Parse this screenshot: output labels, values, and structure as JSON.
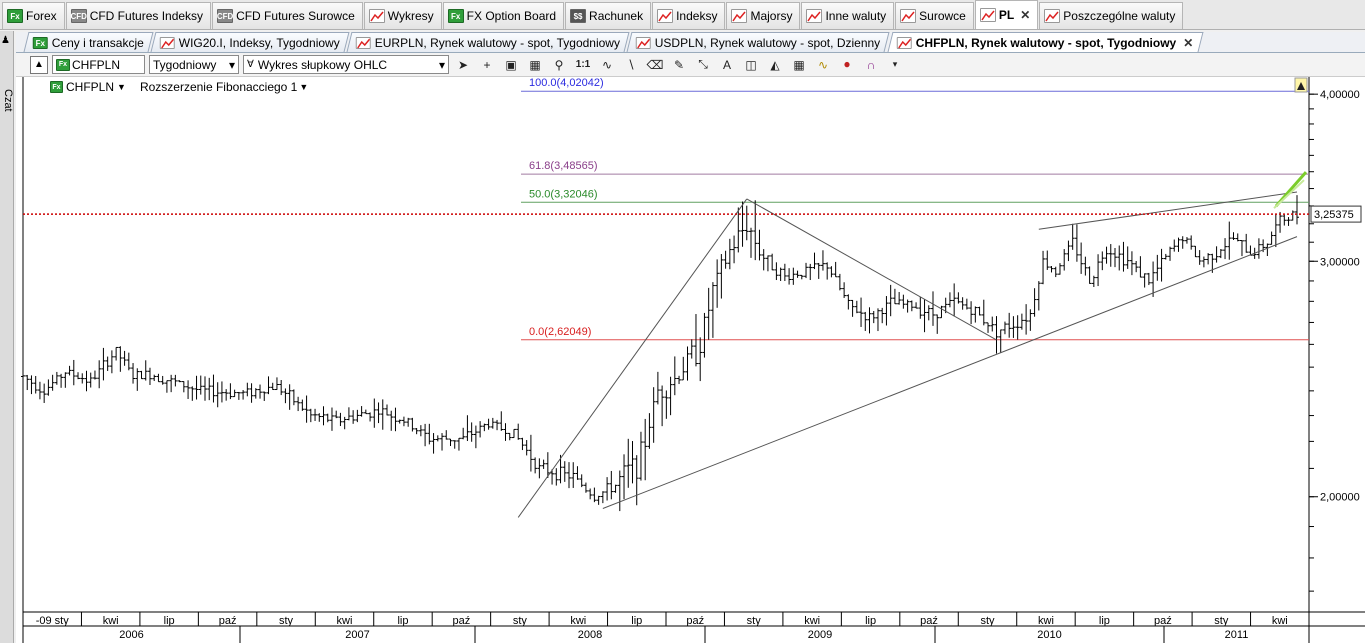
{
  "top_tabs": [
    {
      "label": "Forex",
      "icon": "fx-icon"
    },
    {
      "label": "CFD Futures Indeksy",
      "icon": "cfd-icon"
    },
    {
      "label": "CFD Futures Surowce",
      "icon": "cfd-icon"
    },
    {
      "label": "Wykresy",
      "icon": "chart-icon"
    },
    {
      "label": "FX Option Board",
      "icon": "fx-icon"
    },
    {
      "label": "Rachunek",
      "icon": "bank-icon"
    },
    {
      "label": "Indeksy",
      "icon": "chart-icon"
    },
    {
      "label": "Majorsy",
      "icon": "chart-icon"
    },
    {
      "label": "Inne waluty",
      "icon": "chart-icon"
    },
    {
      "label": "Surowce",
      "icon": "chart-icon"
    },
    {
      "label": "PL",
      "icon": "chart-icon",
      "active": true,
      "closable": true
    },
    {
      "label": "Poszczególne waluty",
      "icon": "chart-icon"
    }
  ],
  "left_strip": {
    "label": "Czat"
  },
  "sub_tabs": [
    {
      "label": "Ceny i transakcje",
      "icon": "fx-icon"
    },
    {
      "label": "WIG20.I, Indeksy, Tygodniowy",
      "icon": "chart-icon"
    },
    {
      "label": "EURPLN, Rynek walutowy - spot, Tygodniowy",
      "icon": "chart-icon"
    },
    {
      "label": "USDPLN, Rynek walutowy - spot, Dzienny",
      "icon": "chart-icon"
    },
    {
      "label": "CHFPLN, Rynek walutowy - spot, Tygodniowy",
      "icon": "chart-icon",
      "active": true,
      "closable": true
    }
  ],
  "toolbar": {
    "symbol": "CHFPLN",
    "period": "Tygodniowy",
    "chart_type": "Wykres słupkowy OHLC",
    "one_to_one": "1:1"
  },
  "chart_header": {
    "instrument": "CHFPLN",
    "study": "Rozszerzenie Fibonacciego 1"
  },
  "colors": {
    "fib100": "#2b2be0",
    "fib618": "#8a3f8a",
    "fib50": "#2a8a2a",
    "fib0": "#d81e1e",
    "price": "#cc0000",
    "arrow": "#7ccd2b"
  },
  "chart_data": {
    "type": "ohlc",
    "instrument": "CHFPLN",
    "timeframe": "Tygodniowy",
    "y_axis": {
      "scale": "log",
      "ylim": [
        1.64,
        4.12
      ],
      "ticks": [
        "4,00000",
        "3,00000",
        "2,00000"
      ],
      "tick_values": [
        4.0,
        3.0,
        2.0
      ]
    },
    "current_price": {
      "label": "3,25375",
      "value": 3.25375
    },
    "fib_levels": [
      {
        "label": "100.0(4,02042)",
        "value": 4.02042
      },
      {
        "label": "61.8(3,48565)",
        "value": 3.48565
      },
      {
        "label": "50.0(3,32046)",
        "value": 3.32046
      },
      {
        "label": "0.0(2,62049)",
        "value": 2.62049
      }
    ],
    "x_months": [
      "-09 sty",
      "kwi",
      "lip",
      "paź",
      "sty",
      "kwi",
      "lip",
      "paź",
      "sty",
      "kwi",
      "lip",
      "paź",
      "sty",
      "kwi",
      "lip",
      "paź",
      "sty",
      "kwi",
      "lip",
      "paź",
      "sty",
      "kwi"
    ],
    "x_years": [
      "2006",
      "2007",
      "2008",
      "2009",
      "2010",
      "2011"
    ],
    "x_range_weeks": [
      0,
      301
    ],
    "trend_lines": [
      {
        "name": "impulse",
        "from": [
          117,
          1.93
        ],
        "to": [
          171,
          3.34
        ]
      },
      {
        "name": "retrace",
        "from": [
          171,
          3.34
        ],
        "to": [
          230,
          2.62
        ]
      },
      {
        "name": "support",
        "from": [
          137,
          1.96
        ],
        "to": [
          301,
          3.13
        ]
      },
      {
        "name": "resistance",
        "from": [
          240,
          3.17
        ],
        "to": [
          301,
          3.38
        ]
      }
    ],
    "anchors": [
      {
        "t": 0,
        "p": 2.46
      },
      {
        "t": 5,
        "p": 2.4
      },
      {
        "t": 10,
        "p": 2.48
      },
      {
        "t": 16,
        "p": 2.44
      },
      {
        "t": 22,
        "p": 2.57
      },
      {
        "t": 26,
        "p": 2.46
      },
      {
        "t": 30,
        "p": 2.47
      },
      {
        "t": 35,
        "p": 2.44
      },
      {
        "t": 42,
        "p": 2.4
      },
      {
        "t": 52,
        "p": 2.39
      },
      {
        "t": 60,
        "p": 2.42
      },
      {
        "t": 68,
        "p": 2.3
      },
      {
        "t": 74,
        "p": 2.28
      },
      {
        "t": 84,
        "p": 2.32
      },
      {
        "t": 90,
        "p": 2.28
      },
      {
        "t": 96,
        "p": 2.21
      },
      {
        "t": 104,
        "p": 2.21
      },
      {
        "t": 110,
        "p": 2.27
      },
      {
        "t": 116,
        "p": 2.23
      },
      {
        "t": 122,
        "p": 2.1
      },
      {
        "t": 130,
        "p": 2.07
      },
      {
        "t": 135,
        "p": 2.0
      },
      {
        "t": 140,
        "p": 2.04
      },
      {
        "t": 146,
        "p": 2.14
      },
      {
        "t": 150,
        "p": 2.4
      },
      {
        "t": 154,
        "p": 2.45
      },
      {
        "t": 160,
        "p": 2.6
      },
      {
        "t": 163,
        "p": 2.85
      },
      {
        "t": 167,
        "p": 3.05
      },
      {
        "t": 171,
        "p": 3.2
      },
      {
        "t": 175,
        "p": 3.02
      },
      {
        "t": 180,
        "p": 2.92
      },
      {
        "t": 185,
        "p": 2.95
      },
      {
        "t": 190,
        "p": 2.98
      },
      {
        "t": 195,
        "p": 2.78
      },
      {
        "t": 200,
        "p": 2.72
      },
      {
        "t": 205,
        "p": 2.79
      },
      {
        "t": 210,
        "p": 2.78
      },
      {
        "t": 215,
        "p": 2.74
      },
      {
        "t": 220,
        "p": 2.8
      },
      {
        "t": 225,
        "p": 2.75
      },
      {
        "t": 230,
        "p": 2.66
      },
      {
        "t": 235,
        "p": 2.7
      },
      {
        "t": 238,
        "p": 2.74
      },
      {
        "t": 241,
        "p": 3.0
      },
      {
        "t": 244,
        "p": 2.95
      },
      {
        "t": 248,
        "p": 3.1
      },
      {
        "t": 252,
        "p": 2.9
      },
      {
        "t": 256,
        "p": 3.07
      },
      {
        "t": 261,
        "p": 3.0
      },
      {
        "t": 266,
        "p": 2.9
      },
      {
        "t": 270,
        "p": 3.02
      },
      {
        "t": 274,
        "p": 3.13
      },
      {
        "t": 278,
        "p": 3.0
      },
      {
        "t": 282,
        "p": 3.05
      },
      {
        "t": 286,
        "p": 3.12
      },
      {
        "t": 290,
        "p": 3.04
      },
      {
        "t": 294,
        "p": 3.1
      },
      {
        "t": 297,
        "p": 3.22
      },
      {
        "t": 301,
        "p": 3.25
      }
    ]
  }
}
